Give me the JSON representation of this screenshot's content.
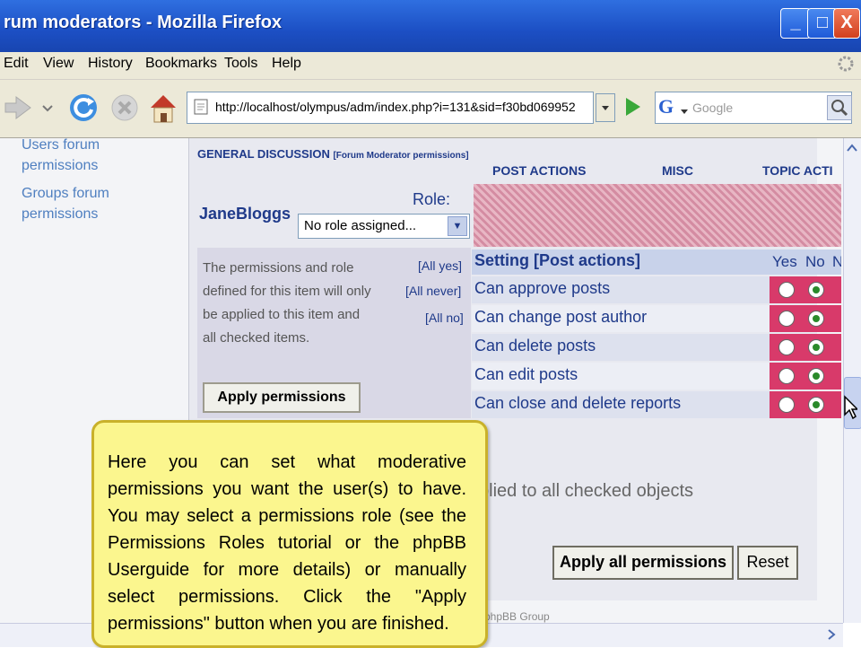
{
  "window": {
    "title": "rum moderators - Mozilla Firefox",
    "min": "_",
    "max": "□",
    "close": "X"
  },
  "menu": [
    "Edit",
    "View",
    "History",
    "Bookmarks",
    "Tools",
    "Help"
  ],
  "nav": {
    "url": "http://localhost/olympus/adm/index.php?i=131&sid=f30bd069952",
    "search_placeholder": "Google",
    "search_engine": "G"
  },
  "sidebar": {
    "items": [
      "Users forum permissions",
      "Groups forum permissions"
    ]
  },
  "forum": {
    "name": "GENERAL DISCUSSION",
    "subtitle": "[Forum Moderator permissions]",
    "columns": [
      "POST ACTIONS",
      "MISC",
      "TOPIC ACTI"
    ]
  },
  "user": {
    "name": "JaneBloggs",
    "role_label": "Role:",
    "role_value": "No role assigned..."
  },
  "description": "The permissions and role defined for this item will only be applied to this item and all checked items.",
  "all_links": [
    "[All yes]",
    "[All never]",
    "[All no]"
  ],
  "apply_button": "Apply permissions",
  "settings": {
    "header": "Setting [Post actions]",
    "col_yes": "Yes",
    "col_no": "No",
    "col_never": "N",
    "rows": [
      {
        "label": "Can approve posts",
        "yes": false,
        "no": true
      },
      {
        "label": "Can change post author",
        "yes": false,
        "no": true
      },
      {
        "label": "Can delete posts",
        "yes": false,
        "no": true
      },
      {
        "label": "Can edit posts",
        "yes": false,
        "no": true
      },
      {
        "label": "Can close and delete reports",
        "yes": false,
        "no": true
      }
    ]
  },
  "applied_text": "plied to all checked objects",
  "apply_all_button": "Apply all permissions",
  "reset_button": "Reset",
  "footer_text": "phpBB Group",
  "tooltip": "Here you can set what moderative permissions you want the user(s) to have. You may select a permissions role (see the Permissions Roles tutorial or the phpBB Userguide for more details) or manually select permissions. Click the \"Apply permissions\" button when you are finished."
}
